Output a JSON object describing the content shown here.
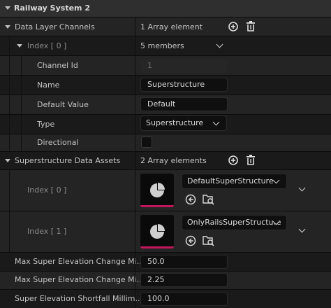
{
  "title": "Railway System 2",
  "data_layer_channels": {
    "label": "Data Layer Channels",
    "summary": "1 Array element",
    "index": {
      "label": "Index [ 0 ]",
      "summary": "5 members"
    },
    "members": {
      "channel_id": {
        "label": "Channel Id",
        "value": "1"
      },
      "name": {
        "label": "Name",
        "value": "Superstructure"
      },
      "default_value": {
        "label": "Default Value",
        "value": "Default"
      },
      "type": {
        "label": "Type",
        "value": "Superstructure"
      },
      "directional": {
        "label": "Directional",
        "checked": false
      }
    }
  },
  "superstructure_data_assets": {
    "label": "Superstructure Data Assets",
    "summary": "2 Array elements",
    "items": [
      {
        "label": "Index [ 0 ]",
        "asset": "DefaultSuperStructure"
      },
      {
        "label": "Index [ 1 ]",
        "asset": "OnlyRailsSuperStructure"
      }
    ]
  },
  "properties": [
    {
      "label": "Max Super Elevation Change Mi...",
      "value": "50.0"
    },
    {
      "label": "Max Super Elevation Change Mi...",
      "value": "2.25"
    },
    {
      "label": "Super Elevation Shortfall Millim...",
      "value": "100.0"
    }
  ],
  "icons": {
    "add": "plus-circle-icon",
    "delete": "trash-icon",
    "browse": "arrow-left-circle-icon",
    "find": "folder-search-icon"
  },
  "colors": {
    "accent_bar": "#c2185b"
  }
}
